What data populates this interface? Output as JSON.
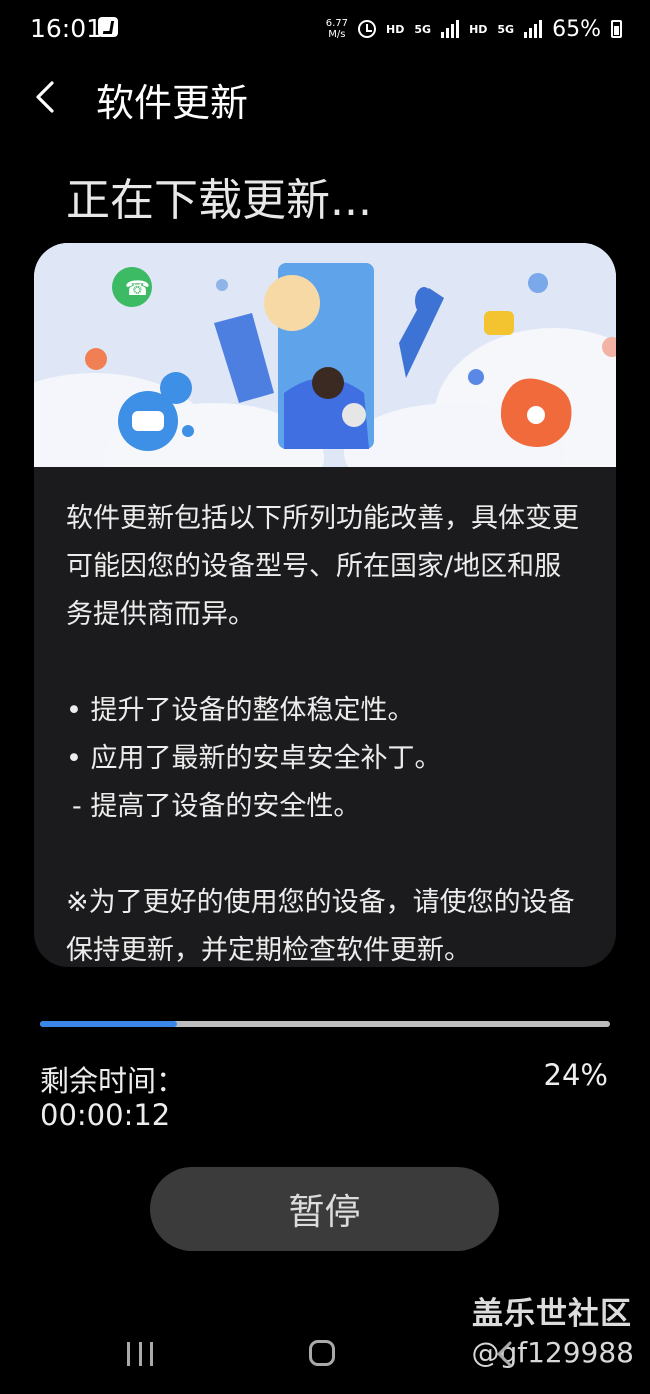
{
  "status_bar": {
    "time": "16:01",
    "net_speed_value": "6.77",
    "net_speed_unit": "M/s",
    "hd1": "HD",
    "g1": "5G",
    "hd2": "HD",
    "g2": "5G",
    "battery": "65%",
    "icons": [
      "app-notification-icon",
      "alarm-icon",
      "signal-icon",
      "battery-icon"
    ]
  },
  "header": {
    "title": "软件更新",
    "back_icon": "back-chevron-icon"
  },
  "heading": "正在下载更新...",
  "card": {
    "intro": "软件更新包括以下所列功能改善，具体变更可能因您的设备型号、所在国家/地区和服务提供商而异。",
    "bullet_1": "• 提升了设备的整体稳定性。",
    "bullet_2": "• 应用了最新的安卓安全补丁。",
    "sub_bullet": "- 提高了设备的安全性。",
    "note": "※为了更好的使用您的设备，请使您的设备保持更新，并定期检查软件更新。"
  },
  "progress": {
    "fraction": 0.24,
    "fill_color": "#3a86e8",
    "track_color": "#bdbdbd",
    "remaining_label": "剩余时间：",
    "remaining_time": "00:00:12",
    "percent_label": "24%"
  },
  "pause_label": "暂停",
  "watermark": {
    "line1": "盖乐世社区",
    "line2": "@gf129988"
  },
  "nav_icons": [
    "recents-icon",
    "home-icon",
    "back-icon"
  ]
}
